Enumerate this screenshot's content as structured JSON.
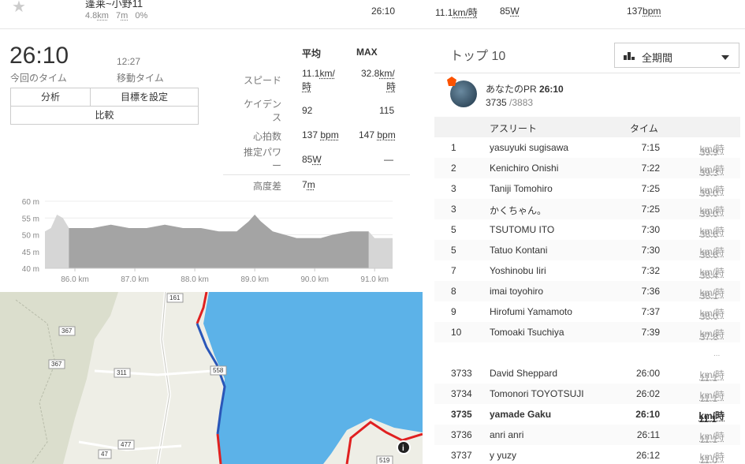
{
  "top_row": {
    "segment_name": "蓬莱~小野11",
    "distance": "4.8",
    "distance_unit": "km",
    "elev": "7",
    "elev_unit": "m",
    "grade": "0%",
    "time": "26:10",
    "speed": "11.1",
    "speed_unit": "km/時",
    "power": "85",
    "power_unit": "W",
    "hr": "137",
    "hr_unit": "bpm"
  },
  "effort": {
    "elapsed_time": "26:10",
    "elapsed_label": "今回のタイム",
    "moving_time": "12:27",
    "moving_label": "移動タイム",
    "buttons": {
      "analysis": "分析",
      "set_goal": "目標を設定",
      "compare": "比較"
    }
  },
  "stats": {
    "head_avg": "平均",
    "head_max": "MAX",
    "speed_label": "スピード",
    "speed_avg": "11.1",
    "speed_max": "32.8",
    "speed_unit_a": "km/",
    "speed_unit_b": "時",
    "cadence_label_a": "ケイデン",
    "cadence_label_b": "ス",
    "cadence_avg": "92",
    "cadence_max": "115",
    "hr_label": "心拍数",
    "hr_avg": "137",
    "hr_max": "147",
    "hr_unit": "bpm",
    "power_label_a": "推定パワ",
    "power_label_b": "ー",
    "power_avg": "85",
    "power_unit": "W",
    "power_max": "—",
    "elev_label": "高度差",
    "elev_val": "7",
    "elev_unit": "m"
  },
  "chart_data": {
    "type": "area",
    "x": [
      85.5,
      85.6,
      85.7,
      85.8,
      85.9,
      86.0,
      86.3,
      86.6,
      86.9,
      87.2,
      87.5,
      87.8,
      88.1,
      88.4,
      88.7,
      88.9,
      89.0,
      89.1,
      89.3,
      89.5,
      89.7,
      89.9,
      90.1,
      90.3,
      90.6,
      90.9,
      91.0,
      91.3
    ],
    "values": [
      51,
      52,
      56,
      55,
      52,
      52,
      52,
      53,
      52,
      52,
      53,
      52,
      52,
      51,
      51,
      54,
      56,
      54,
      51,
      50,
      49,
      49,
      49,
      50,
      51,
      51,
      49,
      49
    ],
    "highlight_range": [
      85.9,
      90.9
    ],
    "xlim": [
      85.5,
      91.3
    ],
    "ylim": [
      40,
      60
    ],
    "yticks": [
      "60 m",
      "55 m",
      "50 m",
      "45 m",
      "40 m"
    ],
    "xticks": [
      "86.0 km",
      "87.0 km",
      "88.0 km",
      "89.0 km",
      "90.0 km",
      "91.0 km"
    ],
    "xtick_values": [
      86,
      87,
      88,
      89,
      90,
      91
    ],
    "ytick_values": [
      60,
      55,
      50,
      45,
      40
    ],
    "colors": {
      "highlight": "#a4a4a4",
      "base": "#d6d6d6"
    }
  },
  "map": {
    "road_labels": [
      "161",
      "367",
      "367",
      "311",
      "558",
      "477",
      "47",
      "519"
    ],
    "route_color": "#e02020",
    "segment_color": "#2a56b8",
    "water_color": "#5cb2e8",
    "land_color": "#eeeee6",
    "info_icon": "info-icon"
  },
  "leaderboard": {
    "title": "トップ 10",
    "period_label": "全期間",
    "pr_label": "あなたのPR",
    "pr_time": "26:10",
    "pr_rank": "3735",
    "pr_total": "/3883",
    "col_athlete": "アスリート",
    "col_time": "タイム",
    "ellipsis": "...",
    "speed_unit": "km/時",
    "top": [
      {
        "rank": "1",
        "name": "yasuyuki sugisawa",
        "time": "7:15",
        "speed": "39.9"
      },
      {
        "rank": "2",
        "name": "Kenichiro Onishi",
        "time": "7:22",
        "speed": "39.3"
      },
      {
        "rank": "3",
        "name": "Taniji Tomohiro",
        "time": "7:25",
        "speed": "39.0"
      },
      {
        "rank": "3",
        "name": "かくちゃん。",
        "time": "7:25",
        "speed": "39.0"
      },
      {
        "rank": "5",
        "name": "TSUTOMU ITO",
        "time": "7:30",
        "speed": "38.6"
      },
      {
        "rank": "5",
        "name": "Tatuo Kontani",
        "time": "7:30",
        "speed": "38.6"
      },
      {
        "rank": "7",
        "name": "Yoshinobu Iiri",
        "time": "7:32",
        "speed": "38.4"
      },
      {
        "rank": "8",
        "name": "imai toyohiro",
        "time": "7:36",
        "speed": "38.1"
      },
      {
        "rank": "9",
        "name": "Hirofumi Yamamoto",
        "time": "7:37",
        "speed": "38.0"
      },
      {
        "rank": "10",
        "name": "Tomoaki Tsuchiya",
        "time": "7:39",
        "speed": "37.8"
      }
    ],
    "around": [
      {
        "rank": "3733",
        "name": "David Sheppard",
        "time": "26:00",
        "speed": "11.1"
      },
      {
        "rank": "3734",
        "name": "Tomonori TOYOTSUJI",
        "time": "26:02",
        "speed": "11.1"
      },
      {
        "rank": "3735",
        "name": "yamade Gaku",
        "time": "26:10",
        "speed": "11.1",
        "me": true
      },
      {
        "rank": "3736",
        "name": "anri anri",
        "time": "26:11",
        "speed": "11.1"
      },
      {
        "rank": "3737",
        "name": "y yuzy",
        "time": "26:12",
        "speed": "11.0"
      }
    ]
  }
}
